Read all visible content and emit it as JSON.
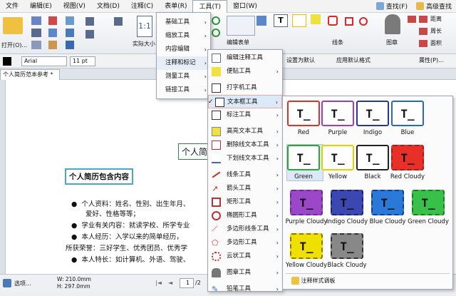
{
  "menubar": {
    "items": [
      "文件",
      "编辑(E)",
      "视图(V)",
      "文档(D)",
      "注释(C)",
      "表单(R)",
      "工具(T)",
      "窗口(W)"
    ],
    "right": [
      "查找(F)",
      "高级查找"
    ]
  },
  "ribbon": {
    "open": "打开(O)...",
    "actual_size": "实际大小",
    "edit_form": "编辑表单",
    "line": "线条",
    "stamp": "图章",
    "distance": "距离",
    "perimeter": "周长",
    "area": "面积"
  },
  "fontbar": {
    "font": "Arial",
    "size": "11 pt",
    "set_default": "设置为默认",
    "apply_default": "应用默认格式",
    "properties": "属性(P)..."
  },
  "tab": {
    "title": "个人简历范本参考 *"
  },
  "doc": {
    "title_partial": "个人简",
    "heading": "个人简历包含内容",
    "bullets": [
      "个人资料：姓名、性别、出生年月、",
      "学业有关内容：就读学校、所学专业",
      "本人经历：入学以来的简单经历，",
      "本人特长：如计算机、外语、驾驶、"
    ],
    "line2": "爱好、性格等等；",
    "line_honors": "所获荣誉：三好学生、优秀团员、优秀学"
  },
  "tools_menu": {
    "items": [
      "基础工具",
      "缩放工具",
      "内容编辑",
      "注释和标记",
      "测量工具",
      "链接工具"
    ]
  },
  "annot_menu": {
    "items": [
      "编辑注释工具",
      "便贴工具",
      "打字机工具",
      "文本框工具",
      "标注工具",
      "高亮文本工具",
      "删除线文本工具",
      "下划线文本工具",
      "线条工具",
      "箭头工具",
      "矩形工具",
      "椭圆形工具",
      "多边形线条工具",
      "多边形工具",
      "云状工具",
      "图章工具",
      "铅笔工具"
    ]
  },
  "palette": {
    "glyph": "T_",
    "items": [
      {
        "label": "Red",
        "color": "#e0302a",
        "fill": "#ffffff"
      },
      {
        "label": "Purple",
        "color": "#a040b0",
        "fill": "#ffffff"
      },
      {
        "label": "Indigo",
        "color": "#283898",
        "fill": "#ffffff"
      },
      {
        "label": "Blue",
        "color": "#2868c8",
        "fill": "#ffffff"
      },
      {
        "label": "Green",
        "color": "#28a838",
        "fill": "#ffffff"
      },
      {
        "label": "Yellow",
        "color": "#e8d000",
        "fill": "#ffffff"
      },
      {
        "label": "Black",
        "color": "#222222",
        "fill": "#ffffff"
      },
      {
        "label": "Red Cloudy",
        "color": "#b01818",
        "fill": "#e83028"
      },
      {
        "label": "Purple Cloudy",
        "color": "#6a2a88",
        "fill": "#9a48c8"
      },
      {
        "label": "Indigo Cloudy",
        "color": "#1a2468",
        "fill": "#3a48b0"
      },
      {
        "label": "Blue Cloudy",
        "color": "#103e88",
        "fill": "#2a78d8"
      },
      {
        "label": "Green Cloudy",
        "color": "#1a7a28",
        "fill": "#38c048"
      },
      {
        "label": "Yellow Cloudy",
        "color": "#8a7800",
        "fill": "#f0e000"
      },
      {
        "label": "Black Cloudy",
        "color": "#333333",
        "fill": "#888888"
      }
    ],
    "footer": "注释样式调板"
  },
  "status": {
    "mode": "选项...",
    "width": "W: 210.0mm",
    "height": "H: 297.0mm",
    "page": "1",
    "pages": "/2"
  }
}
